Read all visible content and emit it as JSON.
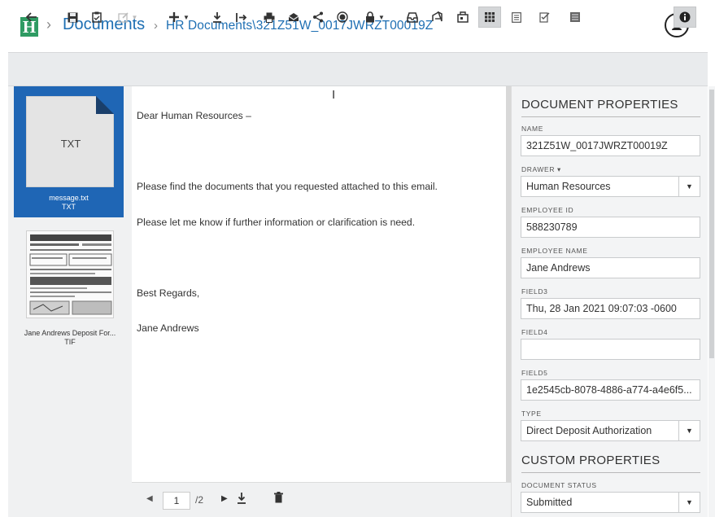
{
  "header": {
    "brand_letter": "H",
    "sep": "›",
    "documents_label": "Documents",
    "path_sep": "›",
    "path": "HR Documents\\321Z51W_0017JWRZT00019Z"
  },
  "toolbar": {
    "icons": [
      "back-icon",
      "save-icon",
      "clipboard-icon",
      "edit-icon",
      "add-icon",
      "download-icon",
      "move-icon",
      "print-icon",
      "email-icon",
      "share-icon",
      "record-icon",
      "lock-icon",
      "inbox-icon",
      "recycle-icon",
      "workflow-icon",
      "grid-view-icon",
      "list-view-icon",
      "checklist-icon",
      "form-icon",
      "info-icon"
    ]
  },
  "thumbnails": [
    {
      "type_label": "TXT",
      "name": "message.txt",
      "ext": "TXT"
    },
    {
      "name": "Jane Andrews Deposit For...",
      "ext": "TIF"
    }
  ],
  "document": {
    "lines": [
      "Dear Human Resources –",
      "",
      "Please find the documents that you requested attached to this email.",
      "Please let me know if further information or clarification is need.",
      "",
      "Best Regards,",
      "Jane Andrews"
    ]
  },
  "pager": {
    "current": "1",
    "total": "/2"
  },
  "properties": {
    "title": "DOCUMENT PROPERTIES",
    "name_label": "NAME",
    "name_value": "321Z51W_0017JWRZT00019Z",
    "drawer_label": "DRAWER ▾",
    "drawer_value": "Human Resources",
    "employee_id_label": "EMPLOYEE ID",
    "employee_id_value": "588230789",
    "employee_name_label": "EMPLOYEE NAME",
    "employee_name_value": "Jane Andrews",
    "field3_label": "FIELD3",
    "field3_value": "Thu, 28 Jan 2021 09:07:03 -0600",
    "field4_label": "FIELD4",
    "field4_value": "",
    "field5_label": "FIELD5",
    "field5_value": "1e2545cb-8078-4886-a774-a4e6f5...",
    "type_label": "TYPE",
    "type_value": "Direct Deposit Authorization"
  },
  "custom": {
    "title": "CUSTOM PROPERTIES",
    "status_label": "DOCUMENT STATUS",
    "status_value": "Submitted"
  },
  "colors": {
    "brand_green": "#2f9b63",
    "link_blue": "#1e6fb3",
    "selection_blue": "#1f66b5",
    "toolbar_bg": "#e9ebed",
    "panel_bg": "#f3f4f5"
  }
}
